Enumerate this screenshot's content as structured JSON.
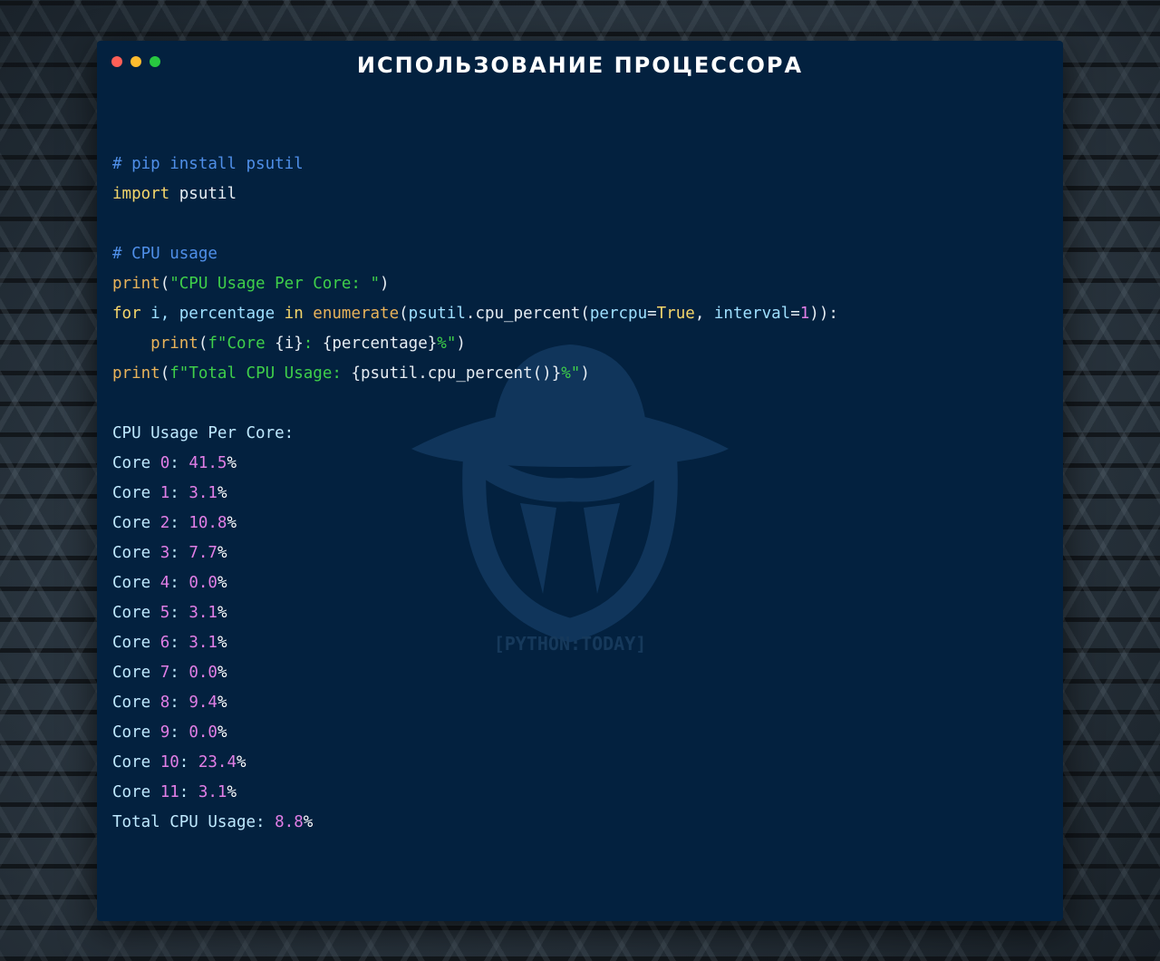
{
  "window": {
    "title": "ИСПОЛЬЗОВАНИЕ ПРОЦЕССОРА",
    "dots": [
      "close",
      "minimize",
      "maximize"
    ],
    "background_color": "#03213f"
  },
  "watermark": {
    "text": "[PYTHON:TODAY]"
  },
  "code": {
    "comment1": "# pip install psutil",
    "import_kw": "import",
    "import_mod": "psutil",
    "comment2": "# CPU usage",
    "print_fn": "print",
    "str_per_core": "\"CPU Usage Per Core: \"",
    "for_kw": "for",
    "for_vars": "i, percentage",
    "in_kw": "in",
    "enumerate_fn": "enumerate",
    "psutil_mod": "psutil",
    "cpu_percent_fn": "cpu_percent",
    "percpu_arg": "percpu",
    "true_val": "True",
    "interval_arg": "interval",
    "one_val": "1",
    "fstr_prefix": "f\"",
    "core_text": "Core ",
    "i_expr": "{i}",
    "colon_text": ": ",
    "percentage_expr": "{percentage}",
    "percent_close": "%\"",
    "total_text": "Total CPU Usage: ",
    "total_expr": "{psutil.cpu_percent()}"
  },
  "output": {
    "header": "CPU Usage Per Core:",
    "core_label": "Core",
    "cores": [
      {
        "index": "0",
        "value": "41.5"
      },
      {
        "index": "1",
        "value": "3.1"
      },
      {
        "index": "2",
        "value": "10.8"
      },
      {
        "index": "3",
        "value": "7.7"
      },
      {
        "index": "4",
        "value": "0.0"
      },
      {
        "index": "5",
        "value": "3.1"
      },
      {
        "index": "6",
        "value": "3.1"
      },
      {
        "index": "7",
        "value": "0.0"
      },
      {
        "index": "8",
        "value": "9.4"
      },
      {
        "index": "9",
        "value": "0.0"
      },
      {
        "index": "10",
        "value": "23.4"
      },
      {
        "index": "11",
        "value": "3.1"
      }
    ],
    "total_label": "Total CPU Usage:",
    "total_value": "8.8",
    "percent_sign": "%"
  }
}
